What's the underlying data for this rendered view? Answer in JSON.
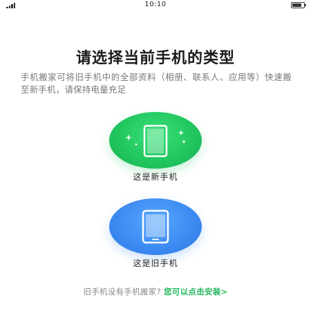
{
  "status_bar": {
    "time": "10:10"
  },
  "header": {
    "title": "请选择当前手机的类型",
    "description": "手机搬家可将旧手机中的全部资料（相册、联系人、应用等）快速搬至新手机，请保持电量充足"
  },
  "options": {
    "new_phone_label": "这是新手机",
    "old_phone_label": "这是旧手机"
  },
  "footer": {
    "prompt": "旧手机没有手机搬家?",
    "install_link": "您可以点击安装>"
  },
  "colors": {
    "new_phone_accent": "#22c760",
    "old_phone_accent": "#3d8cf2",
    "link": "#22b85c"
  },
  "icons": {
    "new_phone": "phone-sparkle-icon",
    "old_phone": "tablet-icon"
  }
}
